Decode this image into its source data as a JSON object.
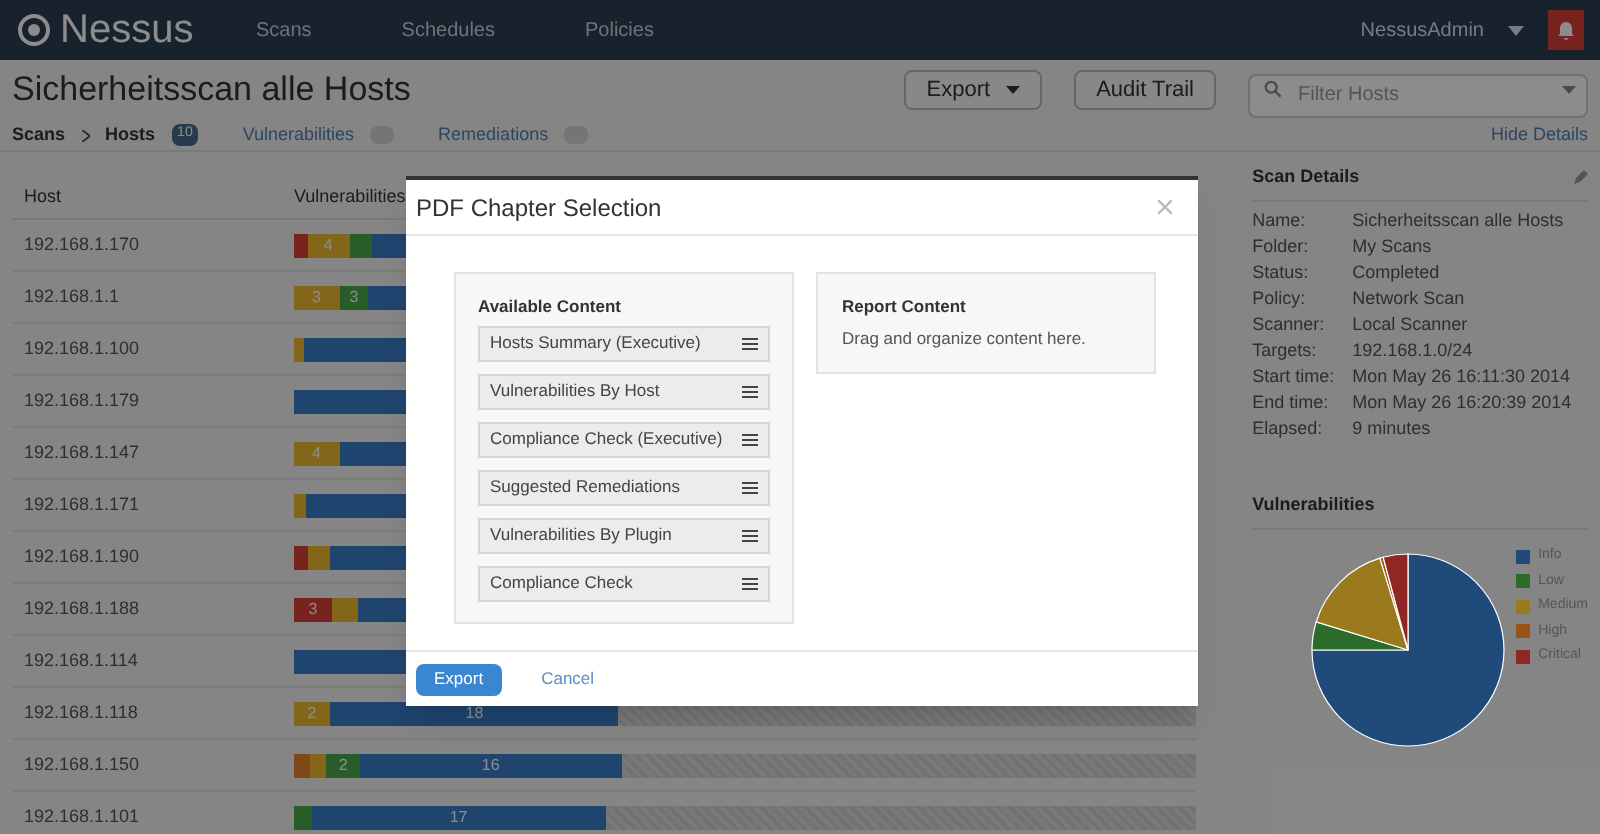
{
  "header": {
    "brand": "Nessus",
    "nav": [
      "Scans",
      "Schedules",
      "Policies"
    ],
    "user": "NessusAdmin"
  },
  "page": {
    "title": "Sicherheitsscan alle Hosts",
    "export_button": "Export",
    "audit_button": "Audit Trail",
    "filter": {
      "placeholder": "Filter Hosts"
    }
  },
  "breadcrumb": {
    "root": "Scans",
    "current": "Hosts",
    "count": "10",
    "tabs": [
      {
        "label": "Vulnerabilities"
      },
      {
        "label": "Remediations"
      }
    ],
    "hide_details": "Hide Details"
  },
  "table": {
    "columns": [
      "Host",
      "Vulnerabilities"
    ],
    "rows": [
      {
        "host": "192.168.1.170",
        "segments": [
          {
            "kind": "critical",
            "level": 0.015
          },
          {
            "kind": "medium",
            "level": 0.061,
            "label": "4"
          },
          {
            "kind": "low",
            "level": 0.087
          },
          {
            "kind": "info",
            "level": 1
          }
        ]
      },
      {
        "host": "192.168.1.1",
        "segments": [
          {
            "kind": "medium",
            "level": 0.05,
            "label": "3"
          },
          {
            "kind": "low",
            "level": 0.083,
            "label": "3"
          },
          {
            "kind": "info",
            "level": 1
          }
        ]
      },
      {
        "host": "192.168.1.100",
        "segments": [
          {
            "kind": "medium",
            "level": 0.011
          },
          {
            "kind": "info",
            "level": 1
          }
        ]
      },
      {
        "host": "192.168.1.179",
        "segments": [
          {
            "kind": "info",
            "level": 1
          }
        ]
      },
      {
        "host": "192.168.1.147",
        "segments": [
          {
            "kind": "medium",
            "level": 0.05,
            "label": "4"
          },
          {
            "kind": "info",
            "level": 1
          }
        ]
      },
      {
        "host": "192.168.1.171",
        "segments": [
          {
            "kind": "medium",
            "level": 0.013
          },
          {
            "kind": "info",
            "level": 1
          }
        ]
      },
      {
        "host": "192.168.1.190",
        "segments": [
          {
            "kind": "critical",
            "level": 0.015
          },
          {
            "kind": "medium",
            "level": 0.039
          },
          {
            "kind": "info",
            "level": 1
          }
        ]
      },
      {
        "host": "192.168.1.188",
        "segments": [
          {
            "kind": "critical",
            "level": 0.042,
            "label": "3"
          },
          {
            "kind": "medium",
            "level": 0.07
          },
          {
            "kind": "info",
            "level": 1
          }
        ]
      },
      {
        "host": "192.168.1.114",
        "segments": [
          {
            "kind": "info",
            "level": 1
          }
        ]
      },
      {
        "host": "192.168.1.118",
        "segments": [
          {
            "kind": "medium",
            "level": 0.04,
            "label": "2"
          },
          {
            "kind": "info",
            "level": 0.36,
            "label": "18"
          }
        ]
      },
      {
        "host": "192.168.1.150",
        "segments": [
          {
            "kind": "high",
            "level": 0.018
          },
          {
            "kind": "medium",
            "level": 0.036
          },
          {
            "kind": "low",
            "level": 0.073,
            "label": "2"
          },
          {
            "kind": "info",
            "level": 0.363,
            "label": "16"
          }
        ]
      },
      {
        "host": "192.168.1.101",
        "segments": [
          {
            "kind": "low",
            "level": 0.02
          },
          {
            "kind": "info",
            "level": 0.345,
            "label": "17"
          }
        ]
      }
    ]
  },
  "details": {
    "title": "Scan Details",
    "fields": [
      {
        "label": "Name:",
        "value": "Sicherheitsscan alle Hosts"
      },
      {
        "label": "Folder:",
        "value": "My Scans"
      },
      {
        "label": "Status:",
        "value": "Completed"
      },
      {
        "label": "Policy:",
        "value": "Network Scan"
      },
      {
        "label": "Scanner:",
        "value": "Local Scanner"
      },
      {
        "label": "Targets:",
        "value": "192.168.1.0/24"
      },
      {
        "label": "Start time:",
        "value": "Mon May 26 16:11:30 2014"
      },
      {
        "label": "End time:",
        "value": "Mon May 26 16:20:39 2014"
      },
      {
        "label": "Elapsed:",
        "value": "9 minutes"
      }
    ]
  },
  "vulnerabilities": {
    "title": "Vulnerabilities",
    "legend": [
      {
        "label": "Info",
        "color": "#1f4a7a"
      },
      {
        "label": "Low",
        "color": "#2b6b2b"
      },
      {
        "label": "Medium",
        "color": "#9a7a1c"
      },
      {
        "label": "High",
        "color": "#985316"
      },
      {
        "label": "Critical",
        "color": "#8f2825"
      }
    ]
  },
  "dialog": {
    "title": "PDF Chapter Selection",
    "available_title": "Available Content",
    "available": [
      "Hosts Summary (Executive)",
      "Vulnerabilities By Host",
      "Compliance Check (Executive)",
      "Suggested Remediations",
      "Vulnerabilities By Plugin",
      "Compliance Check"
    ],
    "report_title": "Report Content",
    "report_hint": "Drag and organize content here.",
    "export_button": "Export",
    "cancel_button": "Cancel"
  }
}
